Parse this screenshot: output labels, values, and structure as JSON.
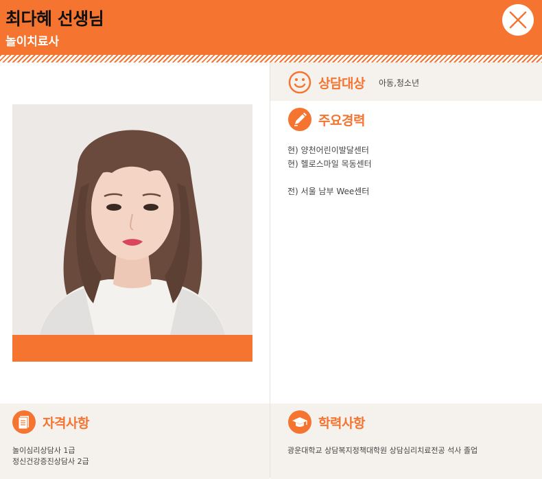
{
  "header": {
    "name": "최다혜 선생님",
    "role": "놀이치료사",
    "close_icon": "close-icon"
  },
  "profile": {
    "photo_icon": "portrait-photo"
  },
  "sangdam": {
    "icon": "smile-icon",
    "title": "상담대상",
    "value": "아동,청소년"
  },
  "career": {
    "icon": "pencil-icon",
    "title": "주요경력",
    "items": [
      "현) 양천어린이발달센터",
      "현) 헬로스마일 목동센터",
      "",
      "전) 서울 남부 Wee센터"
    ]
  },
  "qualifications": {
    "icon": "document-icon",
    "title": "자격사항",
    "items": [
      "놀이심리상담사 1급",
      "정신건강증진상담사 2급"
    ]
  },
  "education": {
    "icon": "graduation-cap-icon",
    "title": "학력사항",
    "value": "광운대학교 상담복지정책대학원 상담심리치료전공 석사 졸업"
  },
  "colors": {
    "accent": "#f47430",
    "beige": "#f5f2ee",
    "text": "#444444"
  }
}
